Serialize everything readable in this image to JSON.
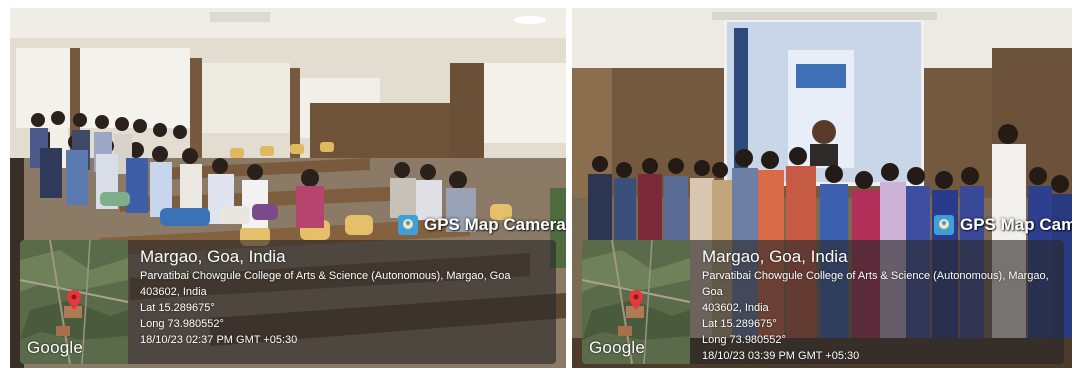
{
  "photos": [
    {
      "brand": "GPS Map Camera",
      "city": "Margao, Goa, India",
      "address_line1": "Parvatibai Chowgule College of Arts & Science (Autonomous), Margao, Goa",
      "address_line2": "403602, India",
      "lat": "Lat 15.289675°",
      "long": "Long 73.980552°",
      "timestamp": "18/10/23 02:37 PM GMT +05:30",
      "map_credit": "Google"
    },
    {
      "brand": "GPS Map Camera",
      "city": "Margao, Goa, India",
      "address_line1": "Parvatibai Chowgule College of Arts & Science (Autonomous), Margao, Goa",
      "address_line2": "403602, India",
      "lat": "Lat 15.289675°",
      "long": "Long 73.980552°",
      "timestamp": "18/10/23 03:39 PM GMT +05:30",
      "map_credit": "Google"
    }
  ],
  "colors": {
    "map_pin": "#e5383b",
    "map_land": "#5a6b4a",
    "stamp_bg": "#282828"
  }
}
